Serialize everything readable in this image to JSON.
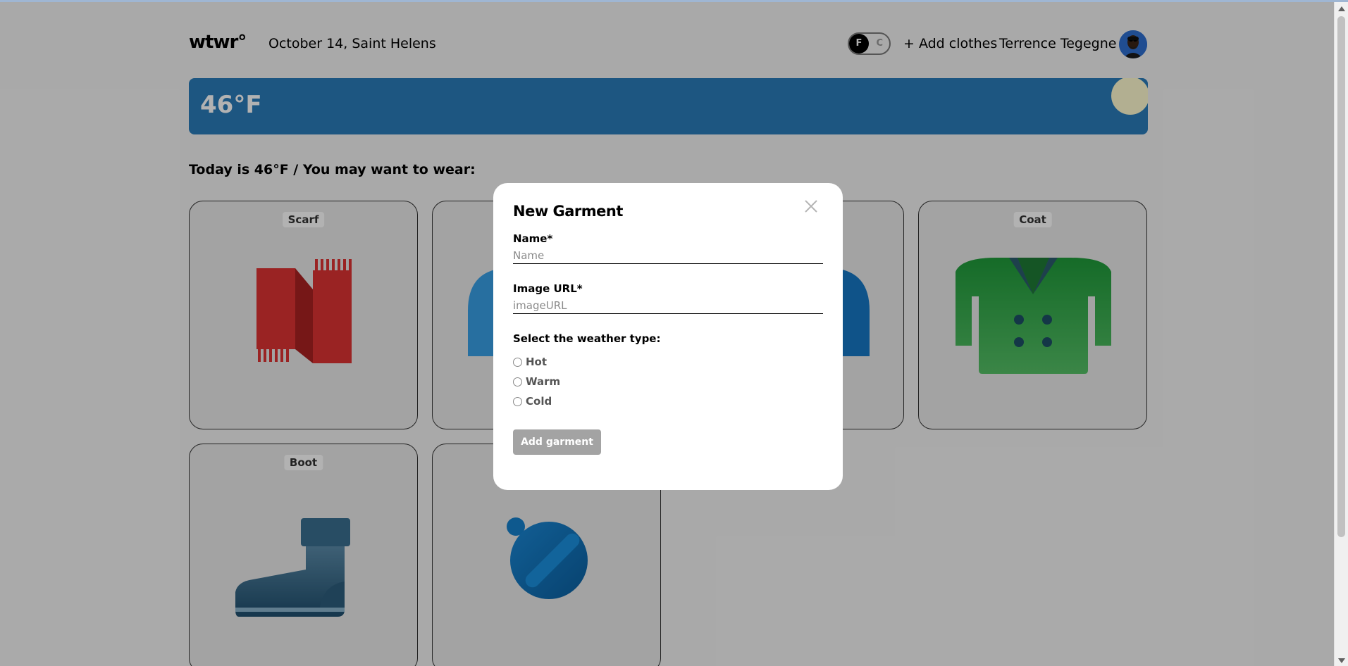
{
  "header": {
    "logo": "wtwr°",
    "date_location": "October 14, Saint Helens",
    "toggle": {
      "active": "F",
      "inactive": "C"
    },
    "add_clothes": "+ Add clothes",
    "username": "Terrence Tegegne"
  },
  "weather": {
    "temperature": "46°F",
    "colors": {
      "card": "#2a7bb9",
      "sun": "#fffbd0"
    }
  },
  "main": {
    "today_text": "Today is 46°F / You may want to wear:",
    "cards": [
      {
        "label": "Scarf",
        "icon": "scarf-icon"
      },
      {
        "label": "",
        "icon": "sweater-icon"
      },
      {
        "label": "",
        "icon": "hoodie-icon"
      },
      {
        "label": "Coat",
        "icon": "coat-icon"
      },
      {
        "label": "Boot",
        "icon": "boot-icon"
      },
      {
        "label": "",
        "icon": "beanie-icon"
      }
    ]
  },
  "modal": {
    "title": "New Garment",
    "close_icon": "close-icon",
    "name_label": "Name*",
    "name_placeholder": "Name",
    "image_label": "Image URL*",
    "image_placeholder": "imageURL",
    "weather_label": "Select the weather type:",
    "options": [
      "Hot",
      "Warm",
      "Cold"
    ],
    "submit_label": "Add garment"
  }
}
